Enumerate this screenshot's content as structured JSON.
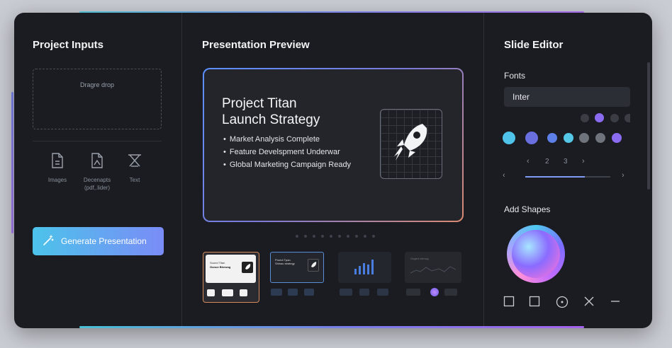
{
  "left_panel": {
    "title": "Project Inputs",
    "dropzone_text": "Dragre drop",
    "upload_types": [
      {
        "label": "Images",
        "icon": "file-image-icon"
      },
      {
        "label": "Decenapts (pdf,.lider)",
        "icon": "document-icon"
      },
      {
        "label": "Text",
        "icon": "text-icon"
      }
    ],
    "generate_button": "Generate Presentation"
  },
  "middle_panel": {
    "title": "Presentation Preview",
    "slide": {
      "title_line1": "Project Titan",
      "title_line2": "Launch Strategy",
      "bullets": [
        "Market Analysis Complete",
        "Feature Develspment Underwar",
        "Global Marketing Campaign Ready"
      ],
      "icon": "rocket-icon"
    },
    "page_dots": 10,
    "thumbnails": [
      {
        "line1": "Sound Titan",
        "line2": "Gonue Bhewog",
        "selected": true
      },
      {
        "line1": "Proect Tpan",
        "line2": "Shinau strategy",
        "selected": false
      },
      {
        "line1": "",
        "line2": "",
        "selected": false
      },
      {
        "line1": "Ooged cienwg",
        "line2": "",
        "selected": false
      }
    ]
  },
  "right_panel": {
    "title": "Slide Editor",
    "fonts_label": "Fonts",
    "font_value": "Inter",
    "pager_value_a": "2",
    "pager_value_b": "3",
    "slider_fraction": 0.7,
    "shapes_label": "Add Shapes",
    "colors": {
      "cyan": "#4fc3ea",
      "indigo": "#6a6fe0",
      "blue": "#5d7fe8",
      "teal": "#55c8e8",
      "grey": "#6f737c",
      "violet": "#8b6cf0",
      "dark": "#3a3d44"
    }
  }
}
